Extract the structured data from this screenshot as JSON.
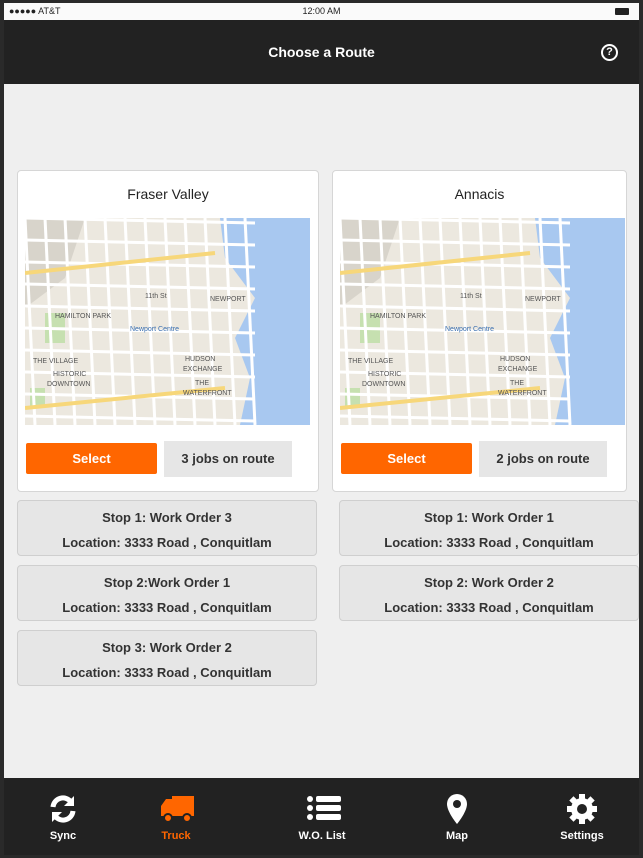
{
  "status_bar": {
    "carrier": "●●●●● AT&T",
    "time": "12:00 AM"
  },
  "header": {
    "title": "Choose a Route",
    "help_icon": "?"
  },
  "accent": "#ff6600",
  "map_labels": {
    "street": "11th St",
    "newport": "NEWPORT",
    "park": "HAMILTON PARK",
    "centre": "Newport Centre",
    "village": "THE VILLAGE",
    "historic": "HISTORIC",
    "downtown": "DOWNTOWN",
    "hudson": "HUDSON",
    "exchange": "EXCHANGE",
    "the": "THE",
    "waterfront": "WATERFRONT"
  },
  "routes": [
    {
      "name": "Fraser Valley",
      "select_label": "Select",
      "jobs": "3 jobs on route",
      "stops": [
        {
          "title": "Stop 1: Work Order 3",
          "location": "Location: 3333 Road , Conquitlam"
        },
        {
          "title": "Stop 2:Work Order 1",
          "location": "Location: 3333 Road , Conquitlam"
        },
        {
          "title": "Stop 3: Work Order 2",
          "location": "Location: 3333 Road , Conquitlam"
        }
      ]
    },
    {
      "name": "Annacis",
      "select_label": "Select",
      "jobs": "2 jobs on route",
      "stops": [
        {
          "title": "Stop 1: Work Order 1",
          "location": "Location: 3333 Road , Conquitlam"
        },
        {
          "title": "Stop 2: Work Order 2",
          "location": "Location: 3333 Road , Conquitlam"
        }
      ]
    }
  ],
  "tabbar": {
    "items": [
      {
        "label": "Sync",
        "icon": "sync-icon"
      },
      {
        "label": "Truck",
        "icon": "truck-icon",
        "active": true
      },
      {
        "label": "W.O. List",
        "icon": "list-icon"
      },
      {
        "label": "Map",
        "icon": "map-pin-icon"
      },
      {
        "label": "Settings",
        "icon": "gear-icon"
      }
    ]
  }
}
